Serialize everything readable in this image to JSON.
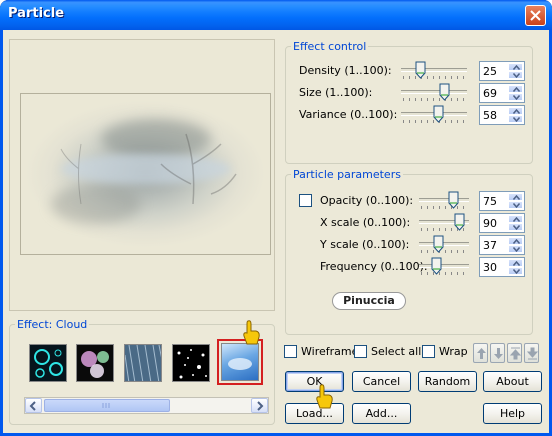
{
  "window": {
    "title": "Particle"
  },
  "effect_control": {
    "legend": "Effect control",
    "rows": [
      {
        "label": "Density (1..100):",
        "value": "25",
        "level": 25
      },
      {
        "label": "Size (1..100):",
        "value": "69",
        "level": 69
      },
      {
        "label": "Variance (0..100):",
        "value": "58",
        "level": 58
      }
    ]
  },
  "particle_parameters": {
    "legend": "Particle parameters",
    "rows": [
      {
        "label": "Opacity (0..100):",
        "value": "75",
        "level": 75
      },
      {
        "label": "X scale (0..100):",
        "value": "90",
        "level": 90
      },
      {
        "label": "Y scale (0..100):",
        "value": "37",
        "level": 37
      },
      {
        "label": "Frequency (0..100):",
        "value": "30",
        "level": 30
      }
    ],
    "logo_text": "Pinuccia"
  },
  "effect": {
    "legend": "Effect: Cloud",
    "thumbnails": [
      "bubbles",
      "glow-dots",
      "rain",
      "stars",
      "cloud"
    ],
    "selected_index": 4
  },
  "options": {
    "wireframe": "Wireframe",
    "select_all": "Select all",
    "wrap": "Wrap"
  },
  "buttons": {
    "ok": "OK",
    "cancel": "Cancel",
    "random": "Random",
    "about": "About",
    "load": "Load...",
    "add": "Add...",
    "help": "Help"
  },
  "colors": {
    "titlebar": "#0058ee",
    "legend": "#0046d5",
    "selection_border": "#d42020",
    "dialog_bg": "#ece9d8"
  }
}
